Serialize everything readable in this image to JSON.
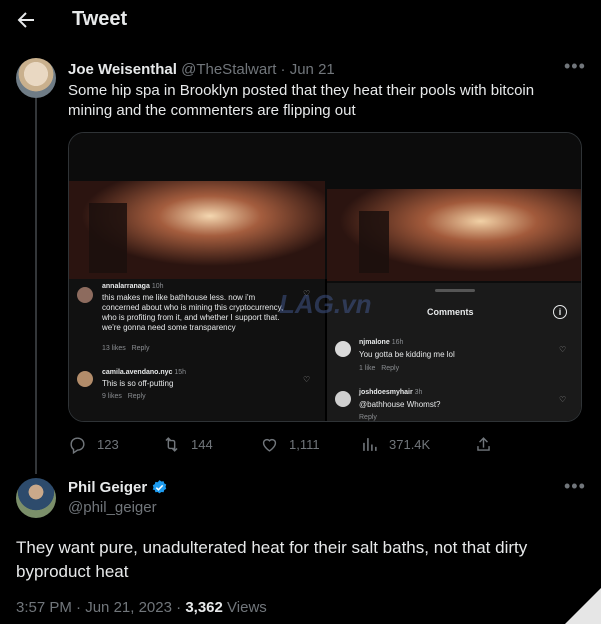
{
  "header": {
    "title": "Tweet"
  },
  "tweet1": {
    "name": "Joe Weisenthal",
    "handle": "@TheStalwart",
    "separator": "·",
    "date": "Jun 21",
    "text": "Some hip spa in Brooklyn posted that they heat their pools with bitcoin mining and the commenters are flipping out",
    "media": {
      "left_comments": [
        {
          "user": "annalarranaga",
          "time": "10h",
          "text": "this makes me like bathhouse less. now i'm concerned about who is mining this cryptocurrency, who is profiting from it, and whether I support that. we're gonna need some transparency",
          "likes": "13 likes",
          "reply": "Reply"
        },
        {
          "user": "camila.avendano.nyc",
          "time": "15h",
          "text": "This is so off-putting",
          "likes": "9 likes",
          "reply": "Reply"
        }
      ],
      "right_panel": {
        "title": "Comments",
        "comments": [
          {
            "user": "njmalone",
            "time": "16h",
            "text": "You gotta be kidding me lol",
            "likes": "1 like",
            "reply": "Reply"
          },
          {
            "user": "joshdoesmyhair",
            "time": "3h",
            "text": "@bathhouse Whomst?",
            "reply": "Reply"
          }
        ]
      },
      "watermark": "LAG.vn"
    },
    "stats": {
      "replies": "123",
      "retweets": "144",
      "likes": "1,111",
      "views": "371.4K"
    }
  },
  "tweet2": {
    "name": "Phil Geiger",
    "handle": "@phil_geiger",
    "text": "They want pure, unadulterated heat for their salt baths, not that dirty byproduct heat",
    "time": "3:57 PM",
    "separator": "·",
    "date": "Jun 21, 2023",
    "views_count": "3,362",
    "views_label": "Views"
  },
  "colors": {
    "background": "#000000",
    "text": "#e7e9ea",
    "muted": "#71767b",
    "verified": "#1d9bf0"
  },
  "icons": [
    "back-arrow-icon",
    "more-icon",
    "reply-icon",
    "retweet-icon",
    "like-icon",
    "views-icon",
    "share-icon",
    "verified-icon",
    "info-icon",
    "heart-icon"
  ]
}
